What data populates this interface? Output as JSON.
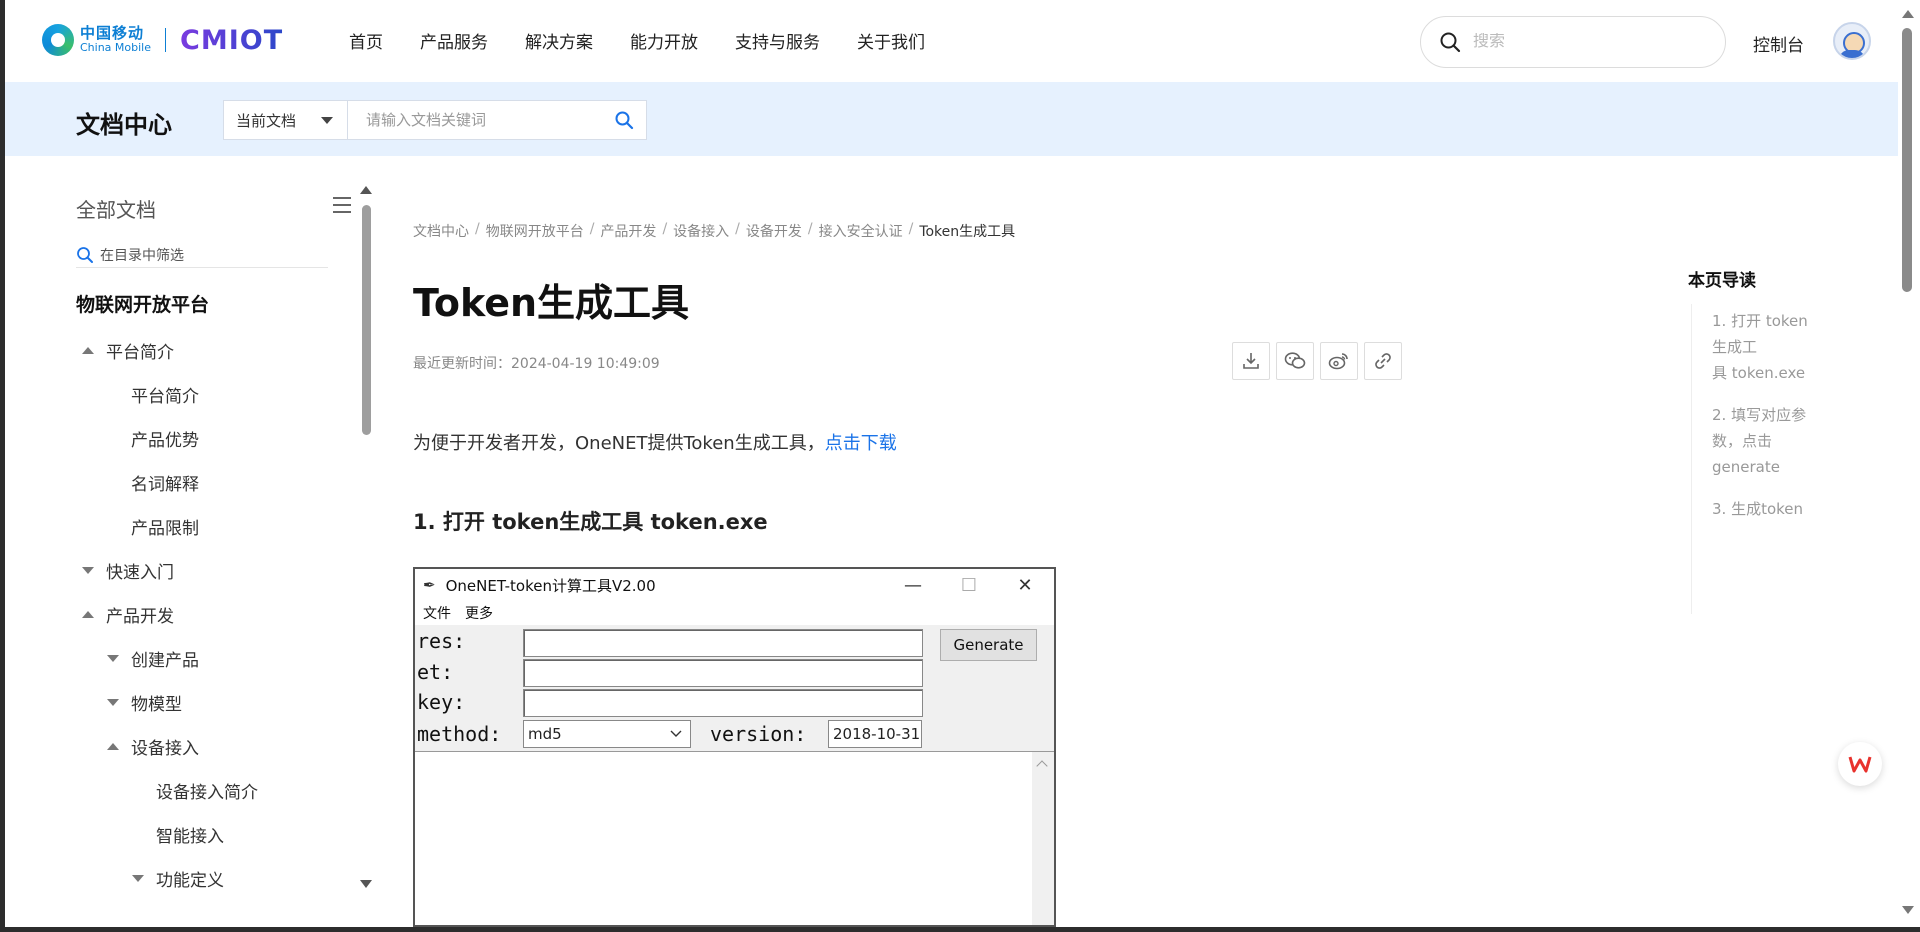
{
  "brand": {
    "cn": "中国移动",
    "en": "China Mobile",
    "product": "CMIOT"
  },
  "nav": {
    "items": [
      "首页",
      "产品服务",
      "解决方案",
      "能力开放",
      "支持与服务",
      "关于我们"
    ],
    "search_placeholder": "搜索",
    "console": "控制台"
  },
  "docband": {
    "title": "文档中心",
    "scope": "当前文档",
    "search_placeholder": "请输入文档关键词"
  },
  "sidebar": {
    "all_docs": "全部文档",
    "filter_placeholder": "在目录中筛选",
    "platform": "物联网开放平台",
    "tree": [
      {
        "label": "平台简介",
        "state": "expanded"
      },
      {
        "label": "平台简介"
      },
      {
        "label": "产品优势"
      },
      {
        "label": "名词解释"
      },
      {
        "label": "产品限制"
      },
      {
        "label": "快速入门",
        "state": "collapsed"
      },
      {
        "label": "产品开发",
        "state": "expanded"
      },
      {
        "label": "创建产品",
        "state": "collapsed"
      },
      {
        "label": "物模型",
        "state": "collapsed"
      },
      {
        "label": "设备接入",
        "state": "expanded"
      },
      {
        "label": "设备接入简介"
      },
      {
        "label": "智能接入"
      },
      {
        "label": "功能定义",
        "state": "collapsed"
      }
    ]
  },
  "breadcrumb": [
    "文档中心",
    "物联网开放平台",
    "产品开发",
    "设备接入",
    "设备开发",
    "接入安全认证",
    "Token生成工具"
  ],
  "article": {
    "title": "Token生成工具",
    "updated": "最近更新时间：2024-04-19 10:49:09",
    "intro_text": "为便于开发者开发，OneNET提供Token生成工具，",
    "intro_link": "点击下载",
    "section1": "1. 打开 token生成工具 token.exe"
  },
  "app_window": {
    "title": "OneNET-token计算工具V2.00",
    "menu": [
      "文件",
      "更多"
    ],
    "labels": {
      "res": "res:",
      "et": "et:",
      "key": "key:",
      "method": "method:",
      "version": "version:"
    },
    "generate": "Generate",
    "method_value": "md5",
    "version_value": "2018-10-31",
    "min": "—",
    "max": "☐",
    "close": "✕"
  },
  "toc": {
    "title": "本页导读",
    "items": [
      "1. 打开 token生成工\n具 token.exe",
      "2. 填写对应参数，点击generate",
      "3. 生成token"
    ]
  },
  "colors": {
    "accent": "#1a73e8",
    "band": "#e6f1fe"
  }
}
